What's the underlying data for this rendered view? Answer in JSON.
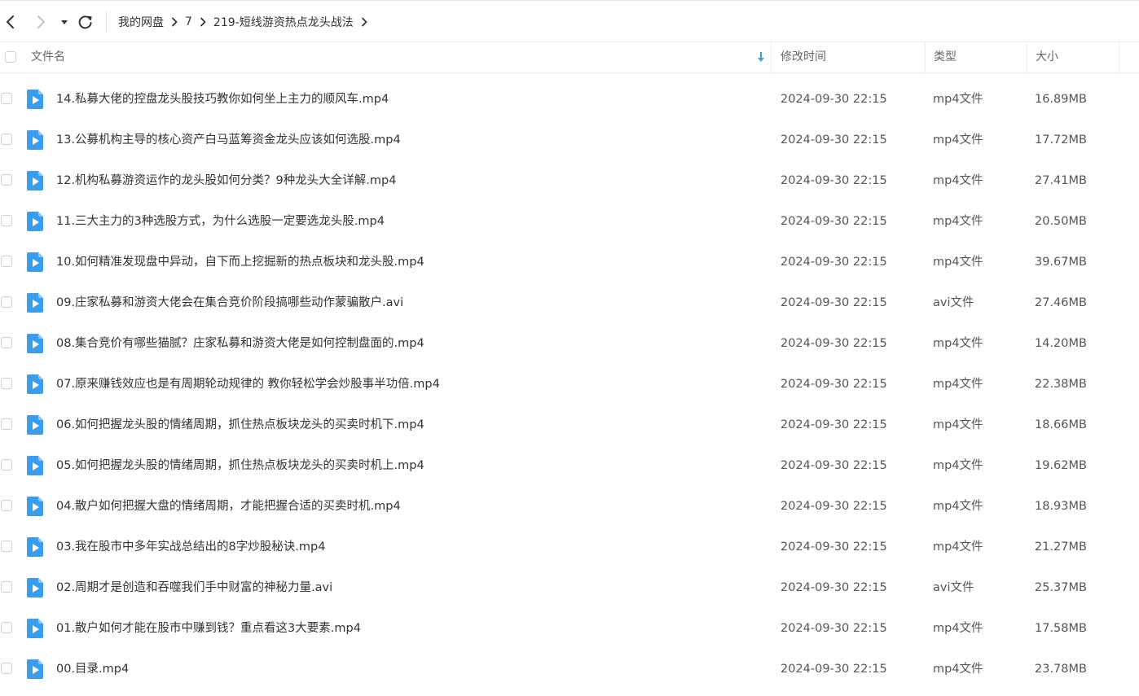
{
  "breadcrumb": [
    "我的网盘",
    "7",
    "219-短线游资热点龙头战法"
  ],
  "columns": {
    "name": "文件名",
    "modified": "修改时间",
    "type": "类型",
    "size": "大小"
  },
  "colors": {
    "file_icon": "#3a9ef0",
    "sort_arrow": "#3a9ef0"
  },
  "icons": {
    "back": "chevron-left-icon",
    "forward": "chevron-right-icon",
    "history": "caret-down-icon",
    "refresh": "refresh-icon",
    "file": "video-file-icon"
  },
  "files": [
    {
      "name": "14.私募大佬的控盘龙头股技巧教你如何坐上主力的顺风车.mp4",
      "modified": "2024-09-30 22:15",
      "type": "mp4文件",
      "size": "16.89MB"
    },
    {
      "name": "13.公募机构主导的核心资产白马蓝筹资金龙头应该如何选股.mp4",
      "modified": "2024-09-30 22:15",
      "type": "mp4文件",
      "size": "17.72MB"
    },
    {
      "name": "12.机构私募游资运作的龙头股如何分类？9种龙头大全详解.mp4",
      "modified": "2024-09-30 22:15",
      "type": "mp4文件",
      "size": "27.41MB"
    },
    {
      "name": "11.三大主力的3种选股方式，为什么选股一定要选龙头股.mp4",
      "modified": "2024-09-30 22:15",
      "type": "mp4文件",
      "size": "20.50MB"
    },
    {
      "name": "10.如何精准发现盘中异动，自下而上挖掘新的热点板块和龙头股.mp4",
      "modified": "2024-09-30 22:15",
      "type": "mp4文件",
      "size": "39.67MB"
    },
    {
      "name": "09.庄家私募和游资大佬会在集合竞价阶段搞哪些动作蒙骗散户.avi",
      "modified": "2024-09-30 22:15",
      "type": "avi文件",
      "size": "27.46MB"
    },
    {
      "name": "08.集合竞价有哪些猫腻？庄家私募和游资大佬是如何控制盘面的.mp4",
      "modified": "2024-09-30 22:15",
      "type": "mp4文件",
      "size": "14.20MB"
    },
    {
      "name": "07.原来赚钱效应也是有周期轮动规律的 教你轻松学会炒股事半功倍.mp4",
      "modified": "2024-09-30 22:15",
      "type": "mp4文件",
      "size": "22.38MB"
    },
    {
      "name": "06.如何把握龙头股的情绪周期，抓住热点板块龙头的买卖时机下.mp4",
      "modified": "2024-09-30 22:15",
      "type": "mp4文件",
      "size": "18.66MB"
    },
    {
      "name": "05.如何把握龙头股的情绪周期，抓住热点板块龙头的买卖时机上.mp4",
      "modified": "2024-09-30 22:15",
      "type": "mp4文件",
      "size": "19.62MB"
    },
    {
      "name": "04.散户如何把握大盘的情绪周期，才能把握合适的买卖时机.mp4",
      "modified": "2024-09-30 22:15",
      "type": "mp4文件",
      "size": "18.93MB"
    },
    {
      "name": "03.我在股市中多年实战总结出的8字炒股秘诀.mp4",
      "modified": "2024-09-30 22:15",
      "type": "mp4文件",
      "size": "21.27MB"
    },
    {
      "name": "02.周期才是创造和吞噬我们手中财富的神秘力量.avi",
      "modified": "2024-09-30 22:15",
      "type": "avi文件",
      "size": "25.37MB"
    },
    {
      "name": "01.散户如何才能在股市中赚到钱？重点看这3大要素.mp4",
      "modified": "2024-09-30 22:15",
      "type": "mp4文件",
      "size": "17.58MB"
    },
    {
      "name": "00.目录.mp4",
      "modified": "2024-09-30 22:15",
      "type": "mp4文件",
      "size": "23.78MB"
    }
  ]
}
